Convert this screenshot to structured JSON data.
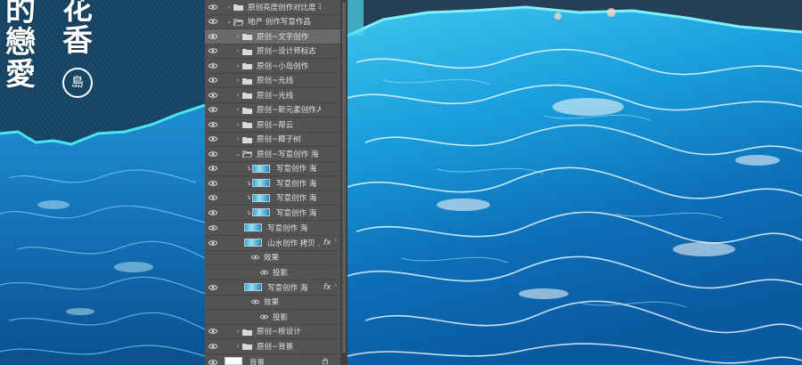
{
  "artwork": {
    "calligraphy_col_1": [
      "的",
      "戀",
      "愛"
    ],
    "calligraphy_col_2": [
      "花",
      "香"
    ],
    "seal": "島"
  },
  "layers": [
    {
      "label": "原创亮度创作对比度 可...",
      "kind": "group",
      "collapsed": true
    },
    {
      "label": "地产 创作写意作品",
      "kind": "group",
      "collapsed": false
    },
    {
      "label": "原创~文字创作",
      "kind": "group",
      "collapsed": true,
      "selected": true
    },
    {
      "label": "原创~设计师标志",
      "kind": "group",
      "collapsed": true
    },
    {
      "label": "原创~小岛创作",
      "kind": "group",
      "collapsed": true
    },
    {
      "label": "原创~光线",
      "kind": "group",
      "collapsed": true
    },
    {
      "label": "原创~光线",
      "kind": "group",
      "collapsed": true
    },
    {
      "label": "原创~新元素创作人 ...",
      "kind": "group",
      "collapsed": true
    },
    {
      "label": "原创~帮云",
      "kind": "group",
      "collapsed": true
    },
    {
      "label": "原创~椰子树",
      "kind": "group",
      "collapsed": true
    },
    {
      "label": "原创~写意创作 海",
      "kind": "group",
      "collapsed": false
    },
    {
      "label": "写意创作 海",
      "kind": "layer",
      "clipped": true
    },
    {
      "label": "写意创作 海",
      "kind": "layer",
      "clipped": true
    },
    {
      "label": "写意创作 海",
      "kind": "layer",
      "clipped": true
    },
    {
      "label": "写意创作 海",
      "kind": "layer",
      "clipped": true
    },
    {
      "label": "写意创作 海",
      "kind": "layer"
    },
    {
      "label": "山水创作 拷贝 ...",
      "kind": "layer",
      "fx": "fx"
    },
    {
      "label": "效果",
      "kind": "effects"
    },
    {
      "label": "投影",
      "kind": "effect"
    },
    {
      "label": "写意创作 海",
      "kind": "layer",
      "fx": "fx"
    },
    {
      "label": "效果",
      "kind": "effects"
    },
    {
      "label": "投影",
      "kind": "effect"
    },
    {
      "label": "原创~榜设计",
      "kind": "group",
      "collapsed": true
    },
    {
      "label": "原创~背景",
      "kind": "group",
      "collapsed": true
    },
    {
      "label": "背景",
      "kind": "background",
      "locked": true
    }
  ],
  "colors": {
    "panel_bg": "#535353",
    "panel_selected": "#6a6a6a",
    "sea_deep": "#0d5a9e",
    "sea_light": "#3cc4ee",
    "foam": "#e8f7ff",
    "night_sky": "#1d3a55"
  }
}
